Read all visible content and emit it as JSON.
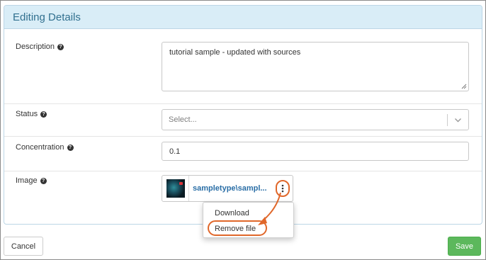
{
  "panel": {
    "title": "Editing Details"
  },
  "fields": {
    "description": {
      "label": "Description",
      "value": "tutorial sample - updated with sources"
    },
    "status": {
      "label": "Status",
      "placeholder": "Select..."
    },
    "concentration": {
      "label": "Concentration",
      "value": "0.1"
    },
    "image": {
      "label": "Image",
      "file_name": "sampletype\\sampl..."
    }
  },
  "file_menu": {
    "items": [
      "Download",
      "Remove file"
    ]
  },
  "footer": {
    "cancel_label": "Cancel",
    "save_label": "Save"
  },
  "icons": {
    "help": "question-circle-icon",
    "kebab": "vertical-ellipsis-icon",
    "chevron": "chevron-down-icon"
  },
  "colors": {
    "heading_bg": "#d9edf7",
    "heading_text": "#31708f",
    "link": "#2a6ea6",
    "annotation": "#e0672a",
    "save_bg": "#5cb85c"
  }
}
